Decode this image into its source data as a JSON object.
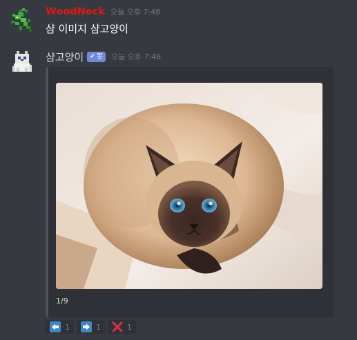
{
  "messages": [
    {
      "username": "WoodNeck",
      "timestamp": "오늘 오후 7:48",
      "text": "샴 이미지 샴고양이",
      "avatar_icon": "green-lizard-pixel-icon",
      "name_color": "#e01818"
    },
    {
      "username": "샴고양이",
      "bot_tag": "봇",
      "timestamp": "오늘 오후 7:48",
      "avatar_icon": "pixel-cat-icon",
      "embed": {
        "image_alt": "siamese-cat-photo",
        "footer": "1/9"
      }
    }
  ],
  "reactions": [
    {
      "icon": "arrow-left-icon",
      "count": "1"
    },
    {
      "icon": "arrow-right-icon",
      "count": "1"
    },
    {
      "icon": "cross-mark-icon",
      "count": "1"
    }
  ],
  "colors": {
    "background": "#36393f",
    "embed_bg": "#2f3136",
    "bot_tag": "#7289da"
  }
}
